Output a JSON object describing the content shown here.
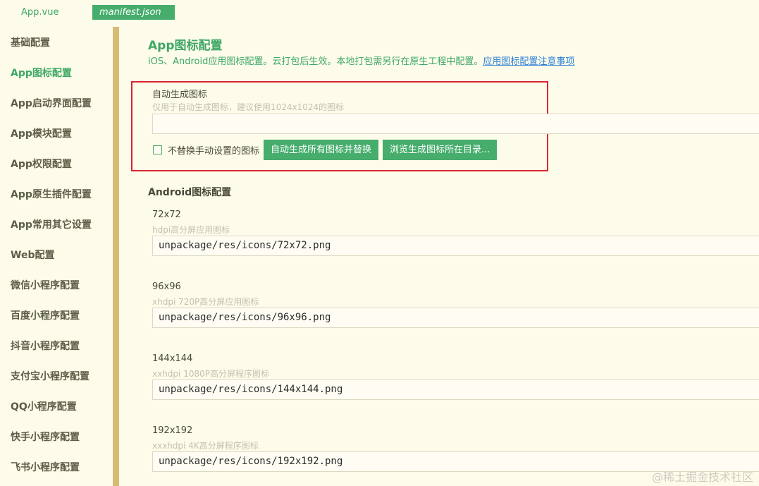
{
  "tabs": [
    {
      "label": "App.vue"
    },
    {
      "label": "manifest.json"
    }
  ],
  "sidebar": {
    "items": [
      {
        "label": "基础配置"
      },
      {
        "label": "App图标配置"
      },
      {
        "label": "App启动界面配置"
      },
      {
        "label": "App模块配置"
      },
      {
        "label": "App权限配置"
      },
      {
        "label": "App原生插件配置"
      },
      {
        "label": "App常用其它设置"
      },
      {
        "label": "Web配置"
      },
      {
        "label": "微信小程序配置"
      },
      {
        "label": "百度小程序配置"
      },
      {
        "label": "抖音小程序配置"
      },
      {
        "label": "支付宝小程序配置"
      },
      {
        "label": "QQ小程序配置"
      },
      {
        "label": "快手小程序配置"
      },
      {
        "label": "飞书小程序配置"
      }
    ]
  },
  "main": {
    "title": "App图标配置",
    "description": "iOS、Android应用图标配置。云打包后生效。本地打包需另行在原生工程中配置。",
    "description_link": "应用图标配置注意事项",
    "auto_icon": {
      "label": "自动生成图标",
      "hint": "仅用于自动生成图标，建议使用1024x1024的图标",
      "value": "",
      "checkbox_label": "不替换手动设置的图标",
      "generate_button": "自动生成所有图标并替换",
      "browse_button": "浏览生成图标所在目录..."
    },
    "android_section_title": "Android图标配置",
    "android_icons": [
      {
        "label": "72x72",
        "hint": "hdpi高分屏应用图标",
        "value": "unpackage/res/icons/72x72.png"
      },
      {
        "label": "96x96",
        "hint": "xhdpi 720P高分屏应用图标",
        "value": "unpackage/res/icons/96x96.png"
      },
      {
        "label": "144x144",
        "hint": "xxhdpi 1080P高分屏程序图标",
        "value": "unpackage/res/icons/144x144.png"
      },
      {
        "label": "192x192",
        "hint": "xxxhdpi 4K高分屏程序图标",
        "value": "unpackage/res/icons/192x192.png"
      }
    ]
  },
  "watermark": "@稀土掘金技术社区",
  "colors": {
    "accent": "#46ad6c",
    "sidebar_divider": "#d5bc74",
    "highlight_border": "#d9262e",
    "link": "#2c7fd6"
  }
}
